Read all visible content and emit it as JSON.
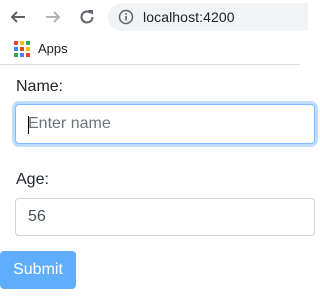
{
  "browser": {
    "url": "localhost:4200",
    "bookmarks": {
      "apps_label": "Apps"
    },
    "apps_colors": [
      "#ea4335",
      "#fbbc05",
      "#34a853",
      "#4285f4",
      "#ea4335",
      "#fbbc05",
      "#34a853",
      "#4285f4",
      "#ea4335"
    ]
  },
  "form": {
    "name_label": "Name:",
    "name_placeholder": "Enter name",
    "name_value": "",
    "age_label": "Age:",
    "age_value": "56",
    "submit_label": "Submit"
  },
  "colors": {
    "submit_bg": "#5faefc",
    "focus_border": "#80bdff"
  }
}
